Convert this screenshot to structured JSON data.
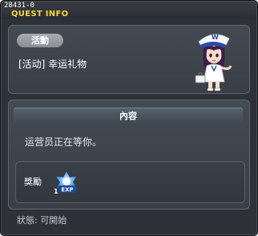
{
  "window": {
    "quest_id": "28431-0",
    "title": "QUEST INFO"
  },
  "quest": {
    "category_tag": "活動",
    "name": "[活动] 幸运礼物"
  },
  "content": {
    "header": "內容",
    "description": "运营员正在等你。"
  },
  "reward": {
    "label": "獎勵",
    "item_icon": "exp-icon",
    "item_text": "EXP",
    "item_count": "1"
  },
  "status": {
    "text": "狀態: 可開始"
  },
  "colors": {
    "title": "#f0d640",
    "window_bg": "#2e3238",
    "panel_border": "#5e6670"
  }
}
